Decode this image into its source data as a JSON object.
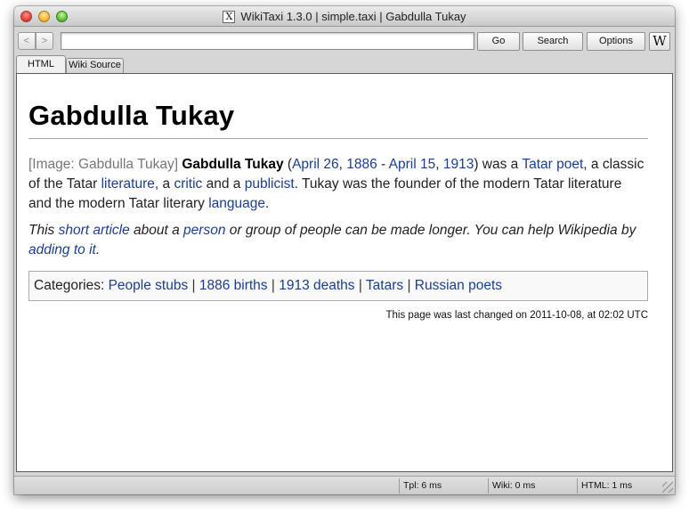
{
  "window": {
    "title": "WikiTaxi 1.3.0 | simple.taxi | Gabdulla Tukay",
    "app_icon_glyph": "X"
  },
  "toolbar": {
    "back_label": "<",
    "forward_label": ">",
    "address_value": "",
    "go_label": "Go",
    "search_label": "Search",
    "options_label": "Options",
    "wiki_label": "W"
  },
  "tabs": [
    {
      "label": "HTML",
      "active": true
    },
    {
      "label": "Wiki Source",
      "active": false
    }
  ],
  "article": {
    "title": "Gabdulla Tukay",
    "intro": {
      "image_placeholder": "[Image: Gabdulla Tukay]",
      "subject": "Gabdulla Tukay",
      "t1": " (",
      "link_birth_date": "April 26",
      "t2": ", ",
      "link_birth_year": "1886",
      "t3": " - ",
      "link_death_date": "April 15",
      "t4": ", ",
      "link_death_year": "1913",
      "t5": ") was a ",
      "link_tatar_poet": "Tatar poet",
      "t6": ", a classic of the Tatar ",
      "link_literature": "literature",
      "t7": ", a ",
      "link_critic": "critic",
      "t8": " and a ",
      "link_publicist": "publicist",
      "t9": ". Tukay was the founder of the modern Tatar literature and the modern Tatar literary ",
      "link_language": "language",
      "t10": "."
    },
    "stub": {
      "s1": "This ",
      "link_short_article": "short article",
      "s2": " about a ",
      "link_person": "person",
      "s3": " or group of people can be made longer. You can help Wikipedia by ",
      "link_adding": "adding to it",
      "s4": "."
    },
    "categories": {
      "label": "Categories:",
      "items": [
        "People stubs",
        "1886 births",
        "1913 deaths",
        "Tatars",
        "Russian poets"
      ],
      "separator": "|"
    },
    "last_changed": "This page was last changed on 2011-10-08, at 02:02 UTC"
  },
  "statusbar": {
    "tpl": "Tpl: 6 ms",
    "wiki": "Wiki: 0 ms",
    "html": "HTML: 1 ms"
  }
}
